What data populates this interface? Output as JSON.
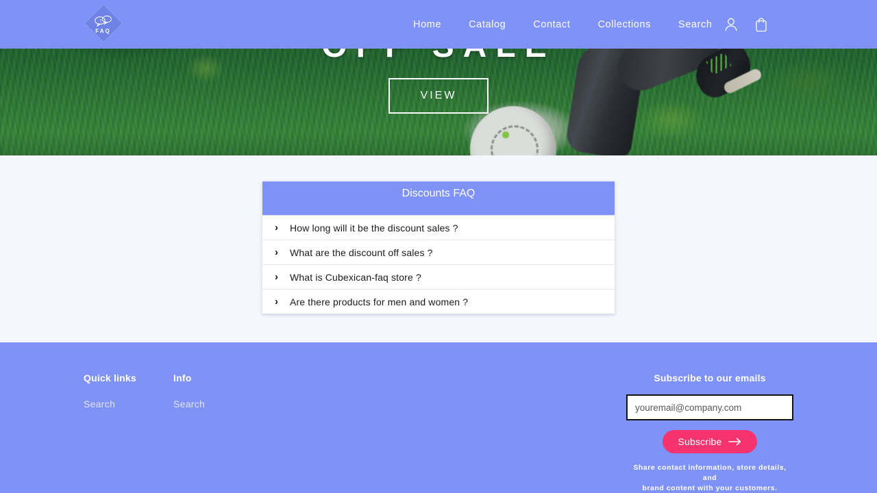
{
  "theme": {
    "brand_blue": "#7f92f7",
    "page_background": "#f4f7fc",
    "accent_pink": "#f5336e",
    "card_white": "#ffffff"
  },
  "header": {
    "logo": {
      "text": "FAQ",
      "icon": "speech-bubbles-icon"
    },
    "nav": [
      {
        "label": "Home"
      },
      {
        "label": "Catalog"
      },
      {
        "label": "Contact"
      },
      {
        "label": "Collections"
      },
      {
        "label": "Search"
      }
    ],
    "icons": [
      {
        "name": "account-icon"
      },
      {
        "name": "cart-icon"
      }
    ]
  },
  "hero": {
    "title": "OFF SALE",
    "button_label": "VIEW",
    "image_description": "child running on grass with a soccer ball"
  },
  "faq": {
    "title": "Discounts FAQ",
    "items": [
      {
        "question": "How long will it be the discount sales ?",
        "chevron": "›"
      },
      {
        "question": "What are the discount off sales ?",
        "chevron": "›"
      },
      {
        "question": "What is Cubexican-faq store ?",
        "chevron": "›"
      },
      {
        "question": "Are there products for men and women ?",
        "chevron": "›"
      }
    ]
  },
  "footer": {
    "columns": [
      {
        "heading": "Quick links",
        "links": [
          {
            "label": "Search"
          }
        ]
      },
      {
        "heading": "Info",
        "links": [
          {
            "label": "Search"
          }
        ]
      }
    ],
    "subscribe": {
      "heading": "Subscribe to our emails",
      "email_value": "",
      "email_placeholder": "youremail@company.com",
      "button_label": "Subscribe",
      "button_icon": "arrow-right-icon",
      "note_line1": "Share contact information, store details, and",
      "note_line2": "brand content with your customers."
    }
  }
}
